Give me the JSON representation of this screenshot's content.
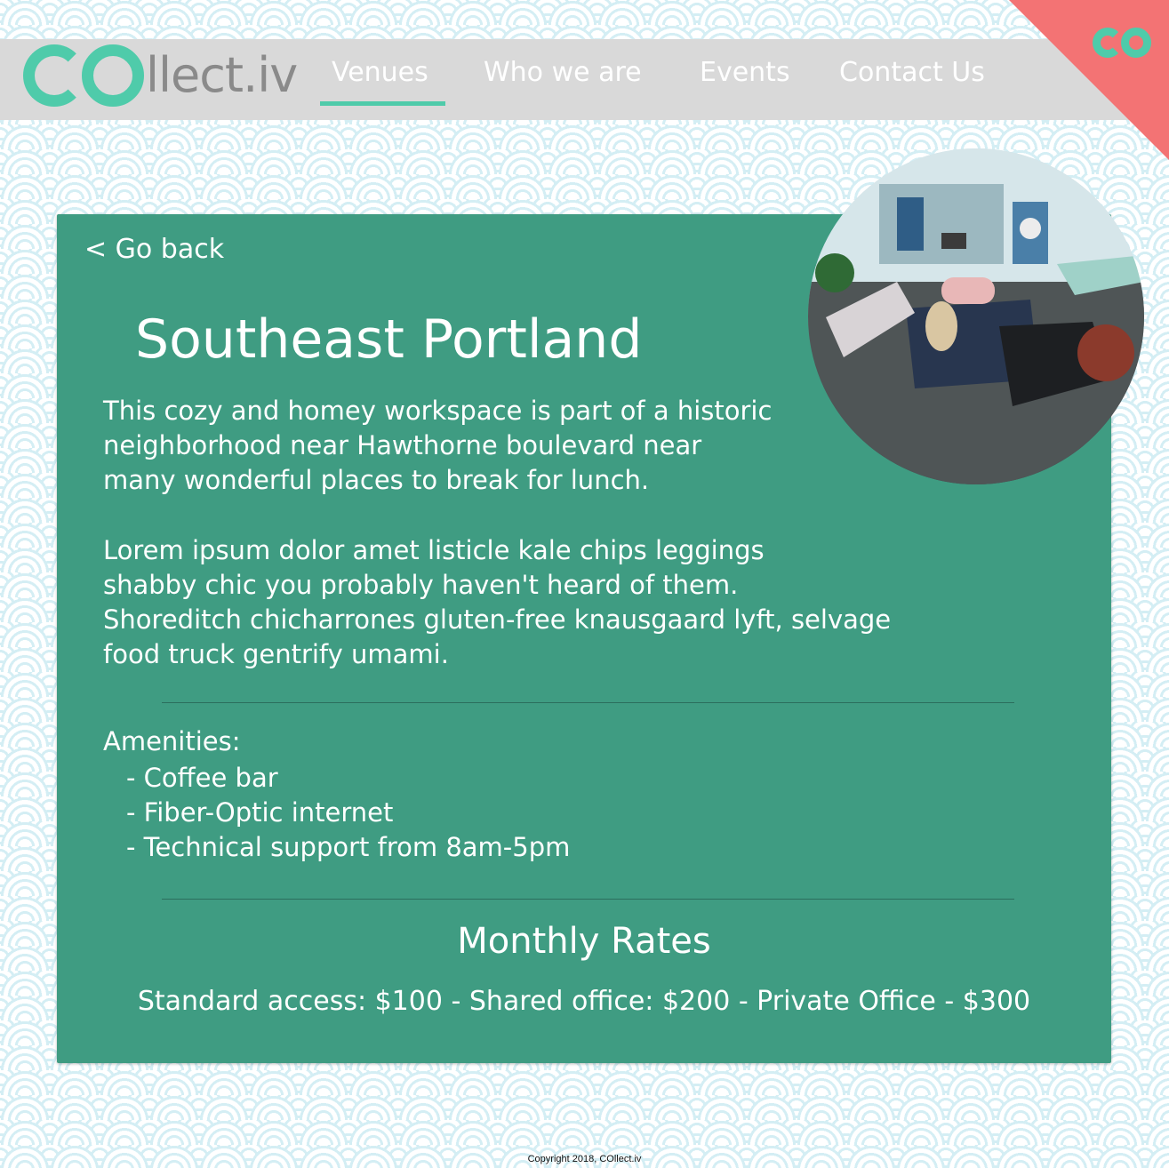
{
  "brand": {
    "logo_text": "llect.iv",
    "colors": {
      "accent": "#4fcbaa",
      "nav_bg": "#d9d9d9",
      "corner": "#f37374",
      "card": "#3f9c82"
    }
  },
  "nav": {
    "items": [
      {
        "label": "Venues",
        "active": true
      },
      {
        "label": "Who we are",
        "active": false
      },
      {
        "label": "Events",
        "active": false
      },
      {
        "label": "Contact Us",
        "active": false
      }
    ]
  },
  "venue": {
    "back_label": "< Go back",
    "title": "Southeast Portland",
    "description_lines": [
      "This cozy and homey workspace is part of a historic",
      "neighborhood near Hawthorne boulevard near",
      "many wonderful places to break for lunch."
    ],
    "lorem_lines": [
      "Lorem ipsum dolor amet listicle kale chips leggings",
      "shabby chic you probably haven't heard of them.",
      "Shoreditch chicharrones gluten-free knausgaard lyft, selvage",
      "food truck gentrify umami."
    ],
    "amenities_title": "Amenities:",
    "amenities": [
      "- Coffee bar",
      "- Fiber-Optic internet",
      "- Technical support from 8am-5pm"
    ],
    "rates_title": "Monthly Rates",
    "rates_text": "Standard access: $100 - Shared office: $200 - Private Office - $300"
  },
  "footer": {
    "text": "Copyright 2018, COllect.iv"
  }
}
